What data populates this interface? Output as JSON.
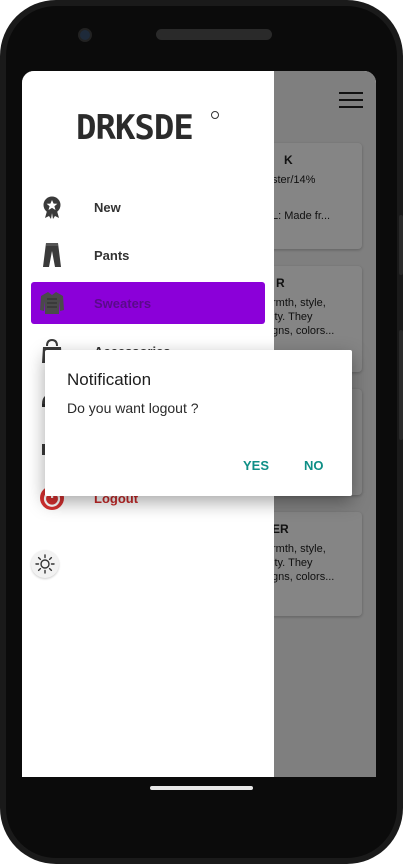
{
  "app": {
    "brand": "DRKSDE",
    "accent_color": "#8b00d9",
    "logout_color": "#c62828"
  },
  "drawer": {
    "items": [
      {
        "label": "New",
        "icon": "badge-star-icon"
      },
      {
        "label": "Pants",
        "icon": "pants-icon"
      },
      {
        "label": "Sweaters",
        "icon": "sweater-icon",
        "active": true
      },
      {
        "label": "Accessories",
        "icon": "bag-icon"
      },
      {
        "label": "",
        "icon": "cap-icon"
      },
      {
        "label": "",
        "icon": "shoe-icon"
      },
      {
        "label": "Logout",
        "icon": "power-icon"
      }
    ],
    "theme_toggle_icon": "sun-icon"
  },
  "background_cards": [
    {
      "title": "K",
      "lines": [
        "ster/14%",
        "",
        "L: Made fr..."
      ]
    },
    {
      "title": "R",
      "lines": [
        "rmth, style,",
        "ity. They",
        "gns, colors..."
      ]
    },
    {
      "title": "",
      "lines": []
    },
    {
      "title": "ER",
      "lines": [
        "rmth, style,",
        "ity. They",
        "gns, colors..."
      ]
    }
  ],
  "dialog": {
    "title": "Notification",
    "message": "Do you want logout ?",
    "yes_label": "YES",
    "no_label": "NO"
  }
}
